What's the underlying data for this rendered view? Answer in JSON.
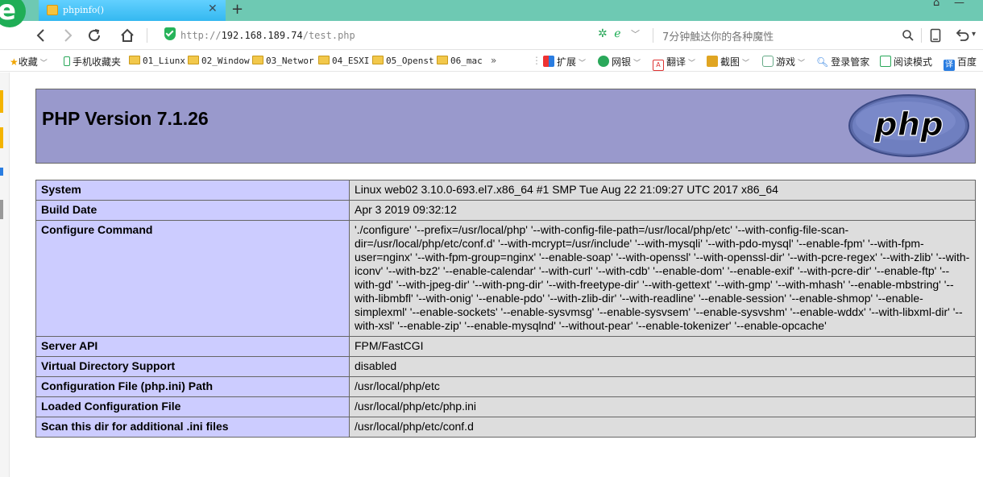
{
  "browser": {
    "tab": {
      "title": "phpinfo()"
    },
    "address": {
      "scheme": "http://",
      "host": "192.168.189.74",
      "path": "/test.php"
    },
    "search_hint": "7分钟触达你的各种魔性",
    "bookmarks": {
      "favorites": "收藏",
      "mobile": "手机收藏夹",
      "folders": [
        "01_Liunx",
        "02_Window",
        "03_Networ",
        "04_ESXI",
        "05_Openst",
        "06_mac"
      ],
      "more": "»"
    },
    "tools": [
      "扩展",
      "网银",
      "翻译",
      "截图",
      "游戏",
      "登录管家",
      "阅读模式",
      "百度"
    ],
    "icons": {
      "logo": "browser-e-logo",
      "back": "back-arrow-icon",
      "forward": "forward-arrow-icon",
      "reload": "reload-icon",
      "home": "home-icon",
      "secure": "shield-icon",
      "search": "search-icon"
    },
    "colors": {
      "tabstrip": "#6ec9b3",
      "tab": "#34b8f0",
      "logo": "#1fae56"
    }
  },
  "phpinfo": {
    "version_title": "PHP Version 7.1.26",
    "logo_text": "php",
    "colors": {
      "header": "#9999cc",
      "key_cell": "#ccccff",
      "value_cell": "#dddddd",
      "border": "#666666"
    },
    "rows": [
      {
        "key": "System",
        "value": "Linux web02 3.10.0-693.el7.x86_64 #1 SMP Tue Aug 22 21:09:27 UTC 2017 x86_64"
      },
      {
        "key": "Build Date",
        "value": "Apr 3 2019 09:32:12"
      },
      {
        "key": "Configure Command",
        "value": "'./configure' '--prefix=/usr/local/php' '--with-config-file-path=/usr/local/php/etc' '--with-config-file-scan-dir=/usr/local/php/etc/conf.d' '--with-mcrypt=/usr/include' '--with-mysqli' '--with-pdo-mysql' '--enable-fpm' '--with-fpm-user=nginx' '--with-fpm-group=nginx' '--enable-soap' '--with-openssl' '--with-openssl-dir' '--with-pcre-regex' '--with-zlib' '--with-iconv' '--with-bz2' '--enable-calendar' '--with-curl' '--with-cdb' '--enable-dom' '--enable-exif' '--with-pcre-dir' '--enable-ftp' '--with-gd' '--with-jpeg-dir' '--with-png-dir' '--with-freetype-dir' '--with-gettext' '--with-gmp' '--with-mhash' '--enable-mbstring' '--with-libmbfl' '--with-onig' '--enable-pdo' '--with-zlib-dir' '--with-readline' '--enable-session' '--enable-shmop' '--enable-simplexml' '--enable-sockets' '--enable-sysvmsg' '--enable-sysvsem' '--enable-sysvshm' '--enable-wddx' '--with-libxml-dir' '--with-xsl' '--enable-zip' '--enable-mysqlnd' '--without-pear' '--enable-tokenizer' '--enable-opcache'"
      },
      {
        "key": "Server API",
        "value": "FPM/FastCGI"
      },
      {
        "key": "Virtual Directory Support",
        "value": "disabled"
      },
      {
        "key": "Configuration File (php.ini) Path",
        "value": "/usr/local/php/etc"
      },
      {
        "key": "Loaded Configuration File",
        "value": "/usr/local/php/etc/php.ini"
      },
      {
        "key": "Scan this dir for additional .ini files",
        "value": "/usr/local/php/etc/conf.d"
      }
    ]
  }
}
